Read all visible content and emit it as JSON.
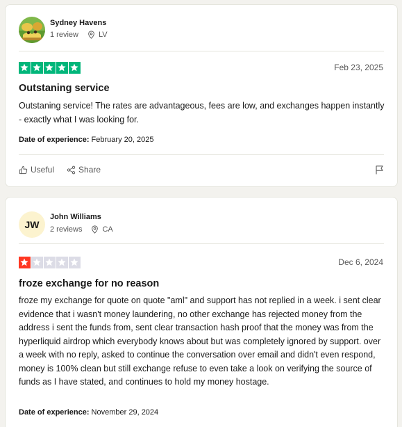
{
  "colors": {
    "five_star": "#00b67a",
    "one_star": "#ff3722",
    "empty_star": "#dcdce6"
  },
  "reviews": [
    {
      "name": "Sydney Havens",
      "review_count": "1 review",
      "location": "LV",
      "rating": 5,
      "date": "Feb 23, 2025",
      "title": "Outstaning service",
      "body": "Outstaning service! The rates are advantageous, fees are low, and exchanges happen instantly - exactly what I was looking for.",
      "experience_label": "Date of experience:",
      "experience_date": "February 20, 2025",
      "useful_label": "Useful",
      "share_label": "Share"
    },
    {
      "initials": "JW",
      "name": "John Williams",
      "review_count": "2 reviews",
      "location": "CA",
      "rating": 1,
      "date": "Dec 6, 2024",
      "title": "froze exchange for no reason",
      "body": "froze my exchange for quote on quote \"aml\" and support has not replied in a week. i sent clear evidence that i wasn't money laundering, no other exchange has rejected money from the address i sent the funds from, sent clear transaction hash proof that the money was from the hyperliquid airdrop which everybody knows about but was completely ignored by support. over a week with no reply, asked to continue the conversation over email and didn't even respond, money is 100% clean but still exchange refuse to even take a look on verifying the source of funds as I have stated, and continues to hold my money hostage.",
      "experience_label": "Date of experience:",
      "experience_date": "November 29, 2024"
    }
  ]
}
